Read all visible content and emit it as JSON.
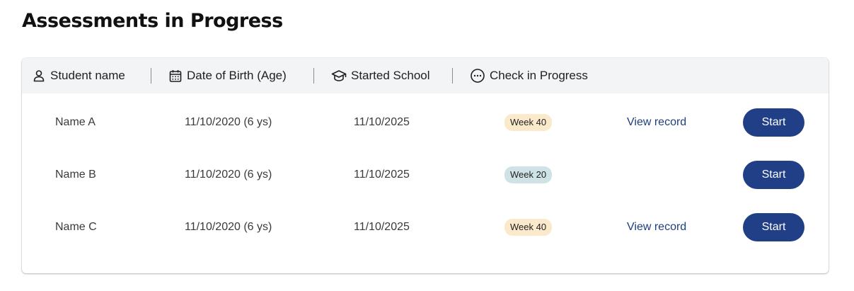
{
  "page": {
    "title": "Assessments in Progress"
  },
  "table": {
    "headers": [
      {
        "label": "Student name",
        "icon": "person-icon"
      },
      {
        "label": "Date of Birth (Age)",
        "icon": "calendar-icon"
      },
      {
        "label": "Started School",
        "icon": "graduation-cap-icon"
      },
      {
        "label": "Check in Progress",
        "icon": "more-horizontal-circle-icon"
      }
    ],
    "rows": [
      {
        "name": "Name A",
        "dob": "11/10/2020 (6 ys)",
        "started": "11/10/2025",
        "week": "Week 40",
        "week_color": "#fbe9cc",
        "view_label": "View record",
        "start_label": "Start"
      },
      {
        "name": "Name B",
        "dob": "11/10/2020 (6 ys)",
        "started": "11/10/2025",
        "week": "Week 20",
        "week_color": "#cfe3e6",
        "view_label": "",
        "start_label": "Start"
      },
      {
        "name": "Name C",
        "dob": "11/10/2020 (6 ys)",
        "started": "11/10/2025",
        "week": "Week 40",
        "week_color": "#fbe9cc",
        "view_label": "View record",
        "start_label": "Start"
      }
    ]
  },
  "colors": {
    "primary_button": "#213f87",
    "link": "#1d3f7e",
    "header_background": "#f3f4f6"
  }
}
